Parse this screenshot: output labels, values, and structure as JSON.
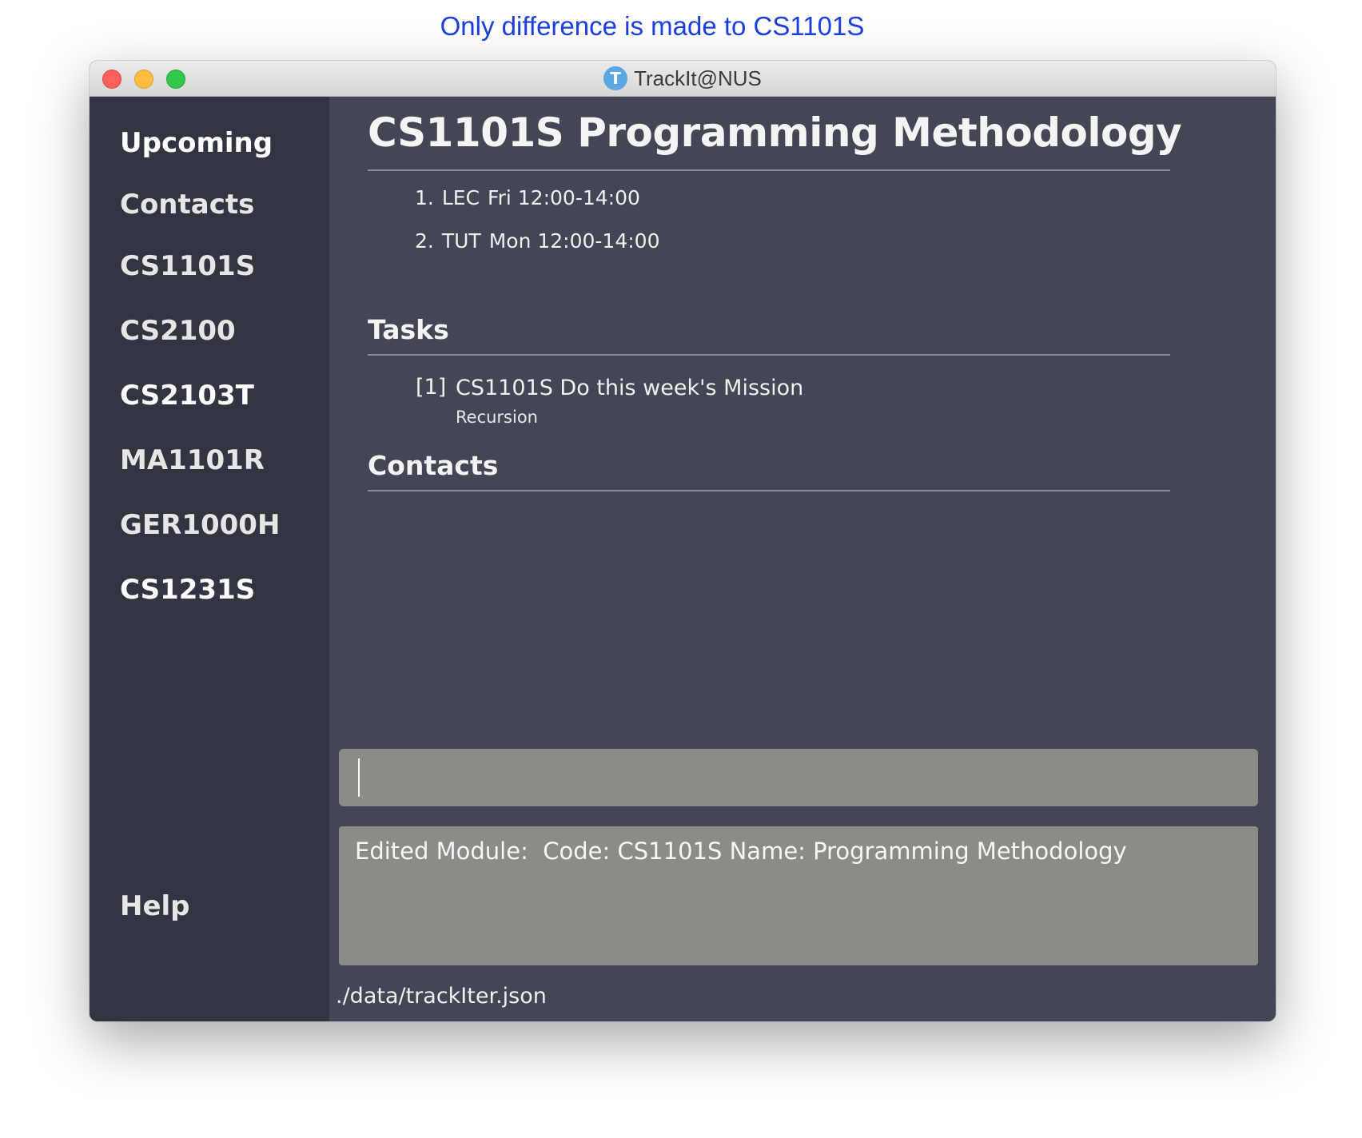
{
  "annotation": "Only difference is made to CS1101S",
  "window": {
    "title": "TrackIt@NUS",
    "app_icon_letter": "T"
  },
  "sidebar": {
    "items": [
      {
        "label": "Upcoming"
      },
      {
        "label": "Contacts"
      },
      {
        "label": "CS1101S"
      },
      {
        "label": "CS2100"
      },
      {
        "label": "CS2103T"
      },
      {
        "label": "MA1101R"
      },
      {
        "label": "GER1000H"
      },
      {
        "label": "CS1231S"
      }
    ],
    "help_label": "Help"
  },
  "module": {
    "title": "CS1101S Programming Methodology",
    "lessons": [
      {
        "index": "1.",
        "type": "LEC",
        "time": "Fri 12:00-14:00"
      },
      {
        "index": "2.",
        "type": "TUT",
        "time": "Mon 12:00-14:00"
      }
    ],
    "tasks_heading": "Tasks",
    "tasks": [
      {
        "index": "[1]",
        "name": "CS1101S Do this week's Mission",
        "description": "Recursion"
      }
    ],
    "contacts_heading": "Contacts"
  },
  "command": {
    "value": ""
  },
  "result": {
    "text": "Edited Module:  Code: CS1101S Name: Programming Methodology"
  },
  "status": {
    "file_path": "./data/trackIter.json"
  },
  "colors": {
    "sidebar_bg": "#323442",
    "main_bg": "#434654",
    "box_bg": "#8b8c88",
    "annotation": "#1c3fe0"
  }
}
